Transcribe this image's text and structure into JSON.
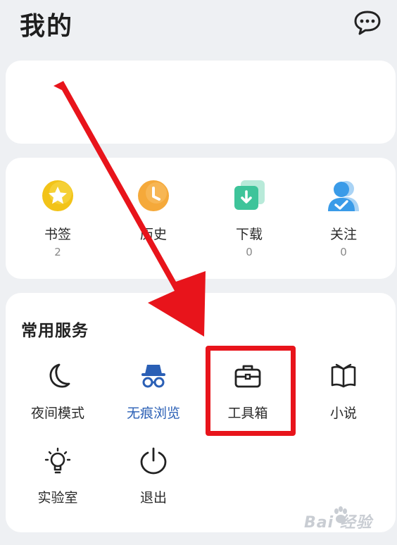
{
  "header": {
    "title": "我的",
    "message_icon": "chat-bubble-icon"
  },
  "stats": [
    {
      "label": "书签",
      "count": "2",
      "icon": "star-icon",
      "color": "#f2c318"
    },
    {
      "label": "历史",
      "count": "",
      "icon": "clock-icon",
      "color": "#f5a93a"
    },
    {
      "label": "下载",
      "count": "0",
      "icon": "download-icon",
      "color": "#3ec49a"
    },
    {
      "label": "关注",
      "count": "0",
      "icon": "user-check-icon",
      "color": "#3a9be8"
    }
  ],
  "services": {
    "title": "常用服务",
    "items": [
      {
        "label": "夜间模式",
        "icon": "moon-icon"
      },
      {
        "label": "无痕浏览",
        "icon": "incognito-icon"
      },
      {
        "label": "工具箱",
        "icon": "toolbox-icon"
      },
      {
        "label": "小说",
        "icon": "book-icon"
      },
      {
        "label": "实验室",
        "icon": "lightbulb-icon"
      },
      {
        "label": "退出",
        "icon": "power-icon"
      }
    ]
  },
  "annotation": {
    "arrow_color": "#e8141b",
    "highlight_color": "#e8141b"
  },
  "watermark": {
    "text": "Bai 经验",
    "logo": "baidu-paw-icon"
  },
  "colors": {
    "accent": "#2a5fb5",
    "background": "#eef0f3"
  }
}
